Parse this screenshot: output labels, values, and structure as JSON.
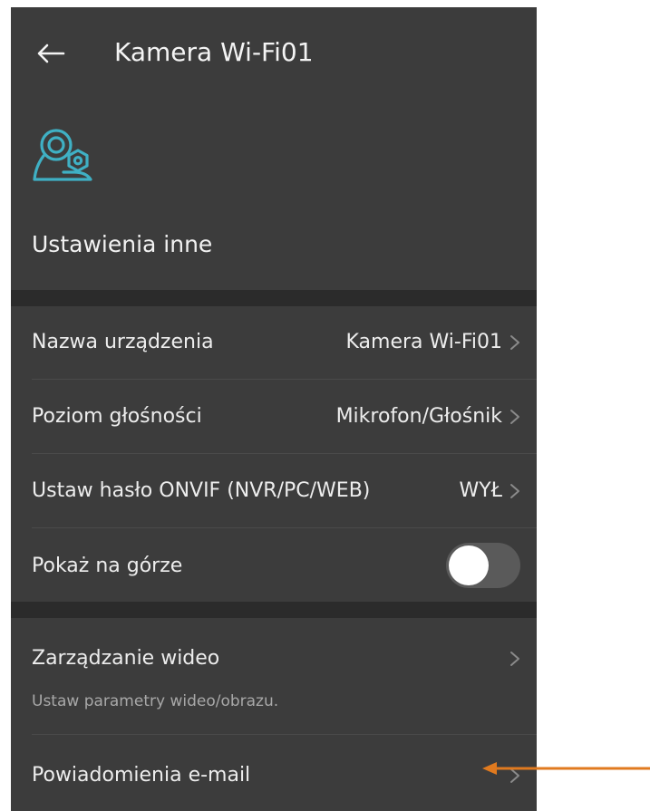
{
  "header": {
    "title": "Kamera Wi-Fi01",
    "back_icon": "arrow-left-icon"
  },
  "device": {
    "icon": "camera-settings-icon",
    "icon_color": "#3fb0c4"
  },
  "section": {
    "heading": "Ustawienia inne"
  },
  "settings": {
    "device_name": {
      "label": "Nazwa urządzenia",
      "value": "Kamera Wi-Fi01"
    },
    "volume": {
      "label": "Poziom głośności",
      "value": "Mikrofon/Głośnik"
    },
    "onvif": {
      "label": "Ustaw hasło ONVIF (NVR/PC/WEB)",
      "value": "WYŁ"
    },
    "show_on_top": {
      "label": "Pokaż na górze",
      "enabled": false
    }
  },
  "more": {
    "video": {
      "label": "Zarządzanie wideo",
      "subtitle": "Ustaw parametry wideo/obrazu."
    },
    "email": {
      "label": "Powiadomienia e-mail"
    }
  },
  "colors": {
    "background": "#3c3c3c",
    "band": "#2b2b2b",
    "annotation_arrow": "#e07a1f"
  }
}
